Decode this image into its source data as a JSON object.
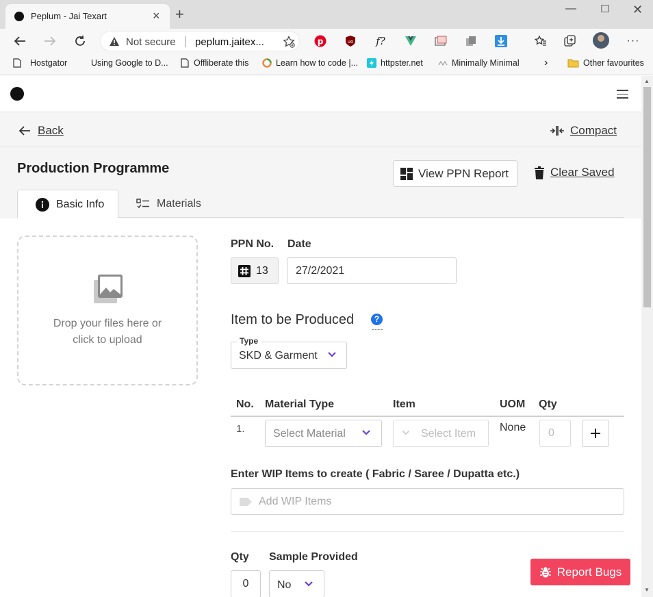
{
  "browser": {
    "tab_title": "Peplum - Jai Texart",
    "security_label": "Not secure",
    "url": "peplum.jaitex...",
    "bookmarks": [
      {
        "label": "Hostgator"
      },
      {
        "label": "Using Google to D..."
      },
      {
        "label": "Offliberate this"
      },
      {
        "label": "Learn how to code |..."
      },
      {
        "label": "httpster.net"
      },
      {
        "label": "Minimally Minimal"
      }
    ],
    "other_favourites": "Other favourites"
  },
  "header": {
    "back_label": "Back",
    "compact_label": "Compact",
    "page_title": "Production Programme",
    "view_report_label": "View PPN Report",
    "clear_saved_label": "Clear Saved"
  },
  "tabs": [
    {
      "label": "Basic Info",
      "icon": "info-icon",
      "active": true
    },
    {
      "label": "Materials",
      "icon": "checklist-icon",
      "active": false
    }
  ],
  "upload": {
    "line1": "Drop your files here or",
    "line2": "click to upload"
  },
  "form": {
    "ppn_label": "PPN No.",
    "ppn_value": "13",
    "date_label": "Date",
    "date_value": "27/2/2021",
    "section_title": "Item to be Produced",
    "help_glyph": "?",
    "type_label": "Type",
    "type_value": "SKD & Garment",
    "table": {
      "headers": [
        "No.",
        "Material Type",
        "Item",
        "UOM",
        "Qty"
      ],
      "rows": [
        {
          "no": "1.",
          "material_placeholder": "Select Material",
          "item_placeholder": "Select Item",
          "uom": "None",
          "qty_placeholder": "0"
        }
      ]
    },
    "wip_label": "Enter WIP Items to create ( Fabric / Saree / Dupatta etc.)",
    "wip_placeholder": "Add WIP Items",
    "qty_label": "Qty",
    "qty_value": "0",
    "sample_label": "Sample Provided",
    "sample_value": "No"
  },
  "report_bugs_label": "Report Bugs",
  "colors": {
    "accent": "#6b3fd4",
    "bug_button": "#f2445e",
    "help_icon": "#1e73e8"
  }
}
